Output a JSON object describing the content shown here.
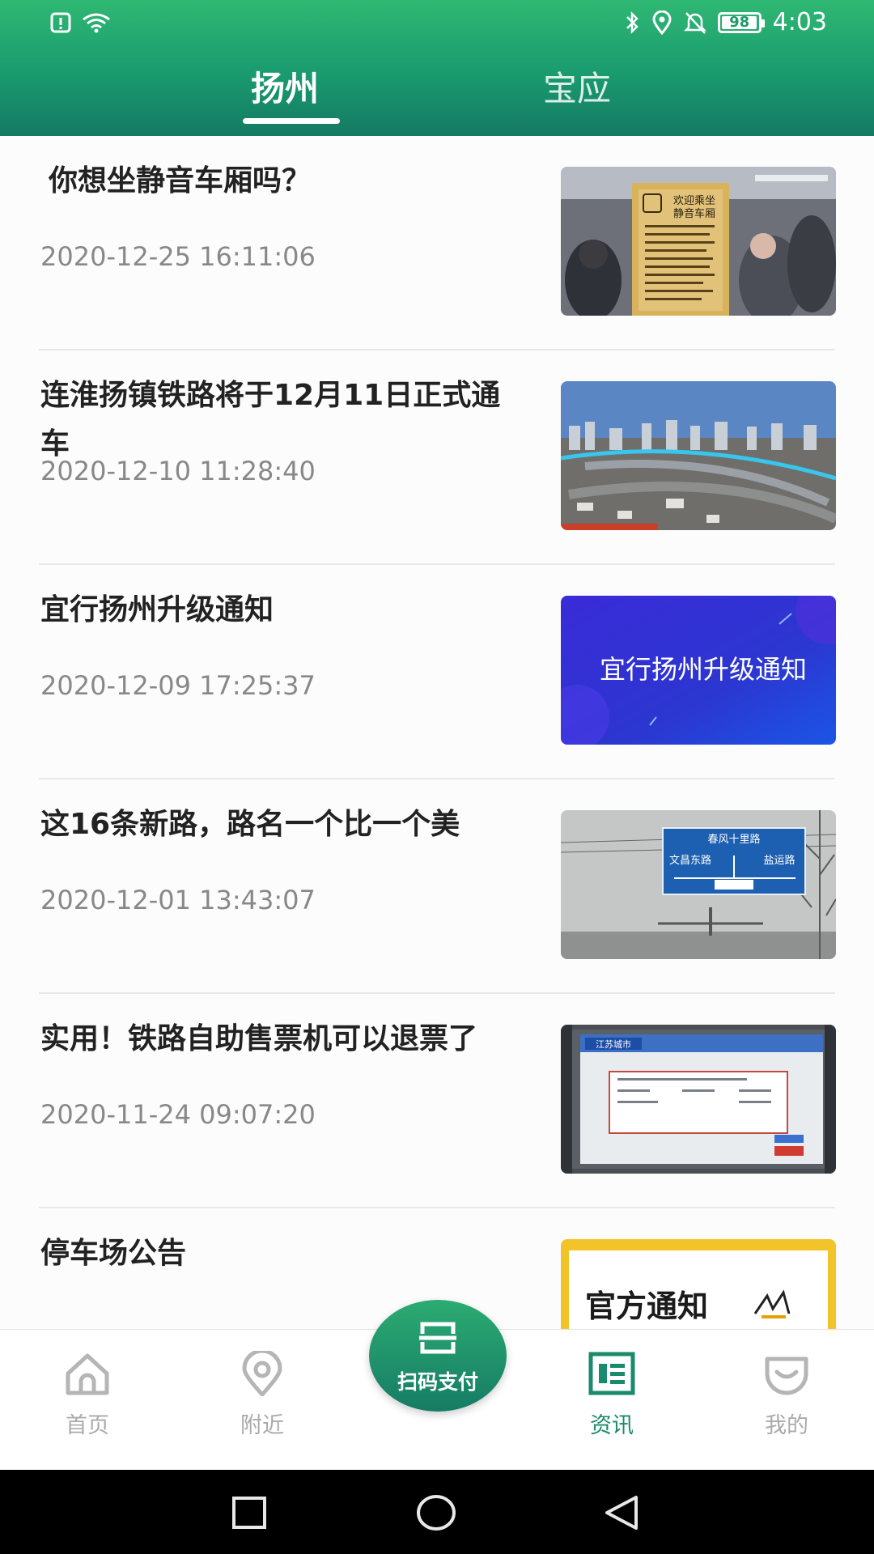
{
  "status_bar": {
    "battery": "98",
    "time": "4:03"
  },
  "tabs": [
    {
      "label": "扬州",
      "active": true
    },
    {
      "label": "宝应",
      "active": false
    }
  ],
  "news": [
    {
      "title": "你想坐静音车厢吗？",
      "date": "2020-12-25 16:11:06",
      "thumb_sign": [
        "欢迎乘坐",
        "静音车厢"
      ]
    },
    {
      "title": "连淮扬镇铁路将于12月11日正式通车",
      "date": "2020-12-10 11:28:40"
    },
    {
      "title": "宜行扬州升级通知",
      "date": "2020-12-09 17:25:37",
      "thumb_text": "宜行扬州升级通知"
    },
    {
      "title": "这16条新路，路名一个比一个美",
      "date": "2020-12-01 13:43:07",
      "thumb_sign": [
        "春风十里路",
        "文昌东路",
        "盐运路"
      ]
    },
    {
      "title": "实用！铁路自助售票机可以退票了",
      "date": "2020-11-24 09:07:20",
      "thumb_logo": "江苏城市"
    },
    {
      "title": "停车场公告",
      "date": "",
      "thumb_text": "官方通知"
    }
  ],
  "bottom_nav": {
    "items": [
      {
        "label": "首页",
        "icon": "home-icon",
        "active": false
      },
      {
        "label": "附近",
        "icon": "location-icon",
        "active": false
      },
      {
        "label": "资讯",
        "icon": "news-icon",
        "active": true
      },
      {
        "label": "我的",
        "icon": "profile-icon",
        "active": false
      }
    ],
    "scan_label": "扫码支付"
  },
  "colors": {
    "header_green": "#1a9a6f",
    "accent": "#1a8a6c",
    "inactive_nav": "#aaaaaa"
  }
}
